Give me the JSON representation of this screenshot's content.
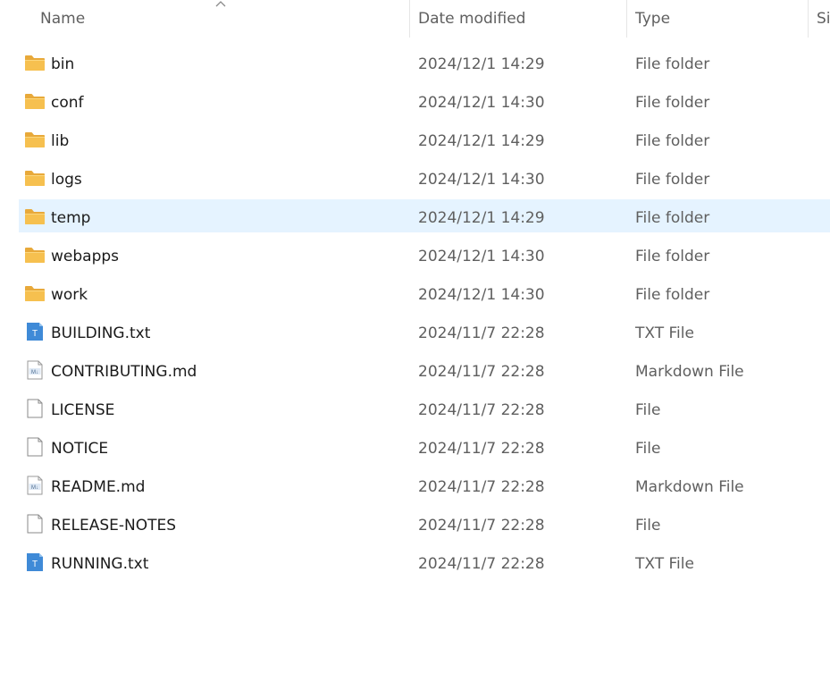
{
  "columns": {
    "name": "Name",
    "date": "Date modified",
    "type": "Type",
    "size": "Si"
  },
  "files": [
    {
      "name": "bin",
      "date": "2024/12/1 14:29",
      "type": "File folder",
      "icon": "folder-icon"
    },
    {
      "name": "conf",
      "date": "2024/12/1 14:30",
      "type": "File folder",
      "icon": "folder-icon"
    },
    {
      "name": "lib",
      "date": "2024/12/1 14:29",
      "type": "File folder",
      "icon": "folder-icon"
    },
    {
      "name": "logs",
      "date": "2024/12/1 14:30",
      "type": "File folder",
      "icon": "folder-icon"
    },
    {
      "name": "temp",
      "date": "2024/12/1 14:29",
      "type": "File folder",
      "icon": "folder-icon",
      "selected": true
    },
    {
      "name": "webapps",
      "date": "2024/12/1 14:30",
      "type": "File folder",
      "icon": "folder-icon"
    },
    {
      "name": "work",
      "date": "2024/12/1 14:30",
      "type": "File folder",
      "icon": "folder-icon"
    },
    {
      "name": "BUILDING.txt",
      "date": "2024/11/7 22:28",
      "type": "TXT File",
      "icon": "text-file-icon"
    },
    {
      "name": "CONTRIBUTING.md",
      "date": "2024/11/7 22:28",
      "type": "Markdown File",
      "icon": "markdown-file-icon"
    },
    {
      "name": "LICENSE",
      "date": "2024/11/7 22:28",
      "type": "File",
      "icon": "blank-file-icon"
    },
    {
      "name": "NOTICE",
      "date": "2024/11/7 22:28",
      "type": "File",
      "icon": "blank-file-icon"
    },
    {
      "name": "README.md",
      "date": "2024/11/7 22:28",
      "type": "Markdown File",
      "icon": "markdown-file-icon"
    },
    {
      "name": "RELEASE-NOTES",
      "date": "2024/11/7 22:28",
      "type": "File",
      "icon": "blank-file-icon"
    },
    {
      "name": "RUNNING.txt",
      "date": "2024/11/7 22:28",
      "type": "TXT File",
      "icon": "text-file-icon"
    }
  ],
  "colors": {
    "folder": "#f6c04f",
    "text_file": "#3f8ad7",
    "selected_row": "#e5f3ff"
  }
}
